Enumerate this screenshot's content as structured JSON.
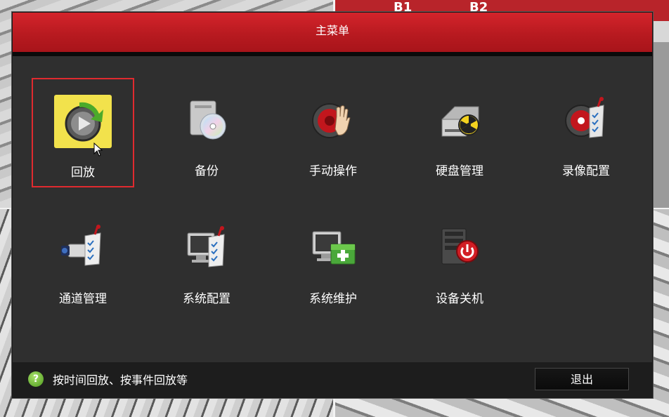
{
  "background": {
    "labels": [
      "B1",
      "B2"
    ]
  },
  "window": {
    "title": "主菜单"
  },
  "menu": {
    "items": [
      {
        "label": "回放",
        "icon": "playback-icon",
        "selected": true
      },
      {
        "label": "备份",
        "icon": "backup-disc-icon",
        "selected": false
      },
      {
        "label": "手动操作",
        "icon": "manual-hand-icon",
        "selected": false
      },
      {
        "label": "硬盘管理",
        "icon": "hdd-management-icon",
        "selected": false
      },
      {
        "label": "录像配置",
        "icon": "record-config-icon",
        "selected": false
      },
      {
        "label": "通道管理",
        "icon": "camera-channel-icon",
        "selected": false
      },
      {
        "label": "系统配置",
        "icon": "system-config-monitor-icon",
        "selected": false
      },
      {
        "label": "系统维护",
        "icon": "system-maintenance-icon",
        "selected": false
      },
      {
        "label": "设备关机",
        "icon": "device-shutdown-icon",
        "selected": false
      }
    ]
  },
  "footer": {
    "hint": "按时间回放、按事件回放等",
    "exit_label": "退出",
    "help_glyph": "?"
  },
  "colors": {
    "titlebar": "#c41e24",
    "selection_border": "#e02a2f",
    "highlight": "#f2e24c",
    "help_green": "#5fae2a"
  }
}
